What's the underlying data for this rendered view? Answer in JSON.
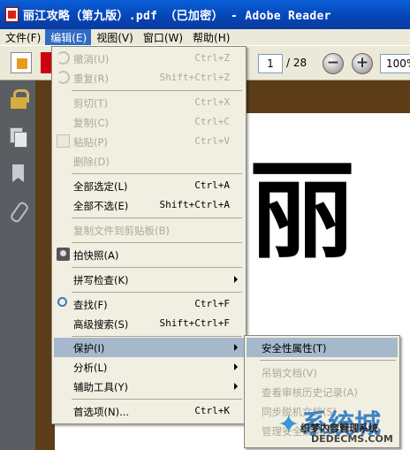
{
  "window": {
    "title": "丽江攻略（第九版）.pdf （已加密） - Adobe Reader"
  },
  "menubar": {
    "items": [
      {
        "label": "文件(F)",
        "active": false
      },
      {
        "label": "编辑(E)",
        "active": true
      },
      {
        "label": "视图(V)",
        "active": false
      },
      {
        "label": "窗口(W)",
        "active": false
      },
      {
        "label": "帮助(H)",
        "active": false
      }
    ]
  },
  "toolbar": {
    "page_current": "1",
    "page_total": "/ 28",
    "zoom_out_glyph": "−",
    "zoom_in_glyph": "+",
    "zoom_value": "100%"
  },
  "document": {
    "visible_char": "丽"
  },
  "edit_menu": {
    "items": [
      {
        "label": "撤消(U)",
        "shortcut": "Ctrl+Z",
        "enabled": false
      },
      {
        "label": "重复(R)",
        "shortcut": "Shift+Ctrl+Z",
        "enabled": false
      },
      {
        "label": "剪切(T)",
        "shortcut": "Ctrl+X",
        "enabled": false
      },
      {
        "label": "复制(C)",
        "shortcut": "Ctrl+C",
        "enabled": false
      },
      {
        "label": "粘贴(P)",
        "shortcut": "Ctrl+V",
        "enabled": false
      },
      {
        "label": "删除(D)",
        "shortcut": "",
        "enabled": false
      },
      {
        "label": "全部选定(L)",
        "shortcut": "Ctrl+A",
        "enabled": true
      },
      {
        "label": "全部不选(E)",
        "shortcut": "Shift+Ctrl+A",
        "enabled": true
      },
      {
        "label": "复制文件到剪贴板(B)",
        "shortcut": "",
        "enabled": false
      },
      {
        "label": "拍快照(A)",
        "shortcut": "",
        "enabled": true
      },
      {
        "label": "拼写检查(K)",
        "shortcut": "",
        "enabled": true
      },
      {
        "label": "查找(F)",
        "shortcut": "Ctrl+F",
        "enabled": true
      },
      {
        "label": "高级搜索(S)",
        "shortcut": "Shift+Ctrl+F",
        "enabled": true
      },
      {
        "label": "保护(I)",
        "shortcut": "",
        "enabled": true
      },
      {
        "label": "分析(L)",
        "shortcut": "",
        "enabled": true
      },
      {
        "label": "辅助工具(Y)",
        "shortcut": "",
        "enabled": true
      },
      {
        "label": "首选项(N)...",
        "shortcut": "Ctrl+K",
        "enabled": true
      }
    ]
  },
  "protect_submenu": {
    "items": [
      {
        "label": "安全性属性(T)",
        "enabled": true
      },
      {
        "label": "吊销文档(V)",
        "enabled": false
      },
      {
        "label": "查看审核历史记录(A)",
        "enabled": false
      },
      {
        "label": "同步脱机文档(S)",
        "enabled": false
      },
      {
        "label": "管理安全策略(M)",
        "enabled": false
      }
    ]
  },
  "watermark": {
    "logo": "系统城",
    "site_name": "织梦内容管理系统",
    "url": "DEDECMS.COM"
  }
}
